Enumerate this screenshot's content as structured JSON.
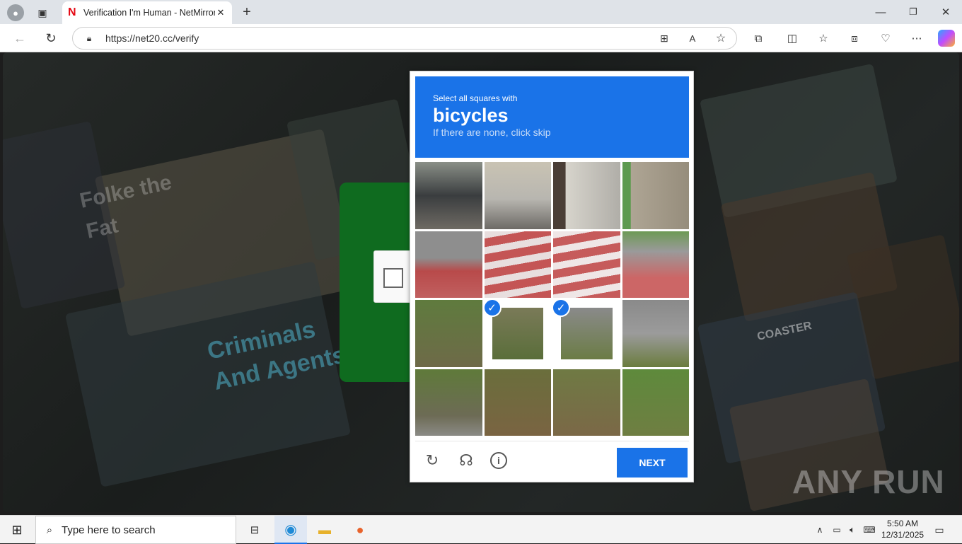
{
  "browser": {
    "tab_title": "Verification I'm Human - NetMirror",
    "url": "https://net20.cc/verify",
    "tab_favicon": "N"
  },
  "background": {
    "poster_text_1": "Folke the Fat",
    "poster_text_2": "Criminals And Agents",
    "poster_text_3": "COASTER",
    "watermark": "ANY RUN"
  },
  "captcha": {
    "prompt_line1": "Select all squares with",
    "target": "bicycles",
    "hint": "If there are none, click skip",
    "next_label": "NEXT",
    "selected_tiles": [
      9,
      10
    ],
    "check_mark": "✓"
  },
  "taskbar": {
    "search_placeholder": "Type here to search",
    "time": "5:50 AM",
    "date": "12/31/2025"
  },
  "colors": {
    "accent": "#1a73e8",
    "green_panel": "#0f6b1f"
  }
}
